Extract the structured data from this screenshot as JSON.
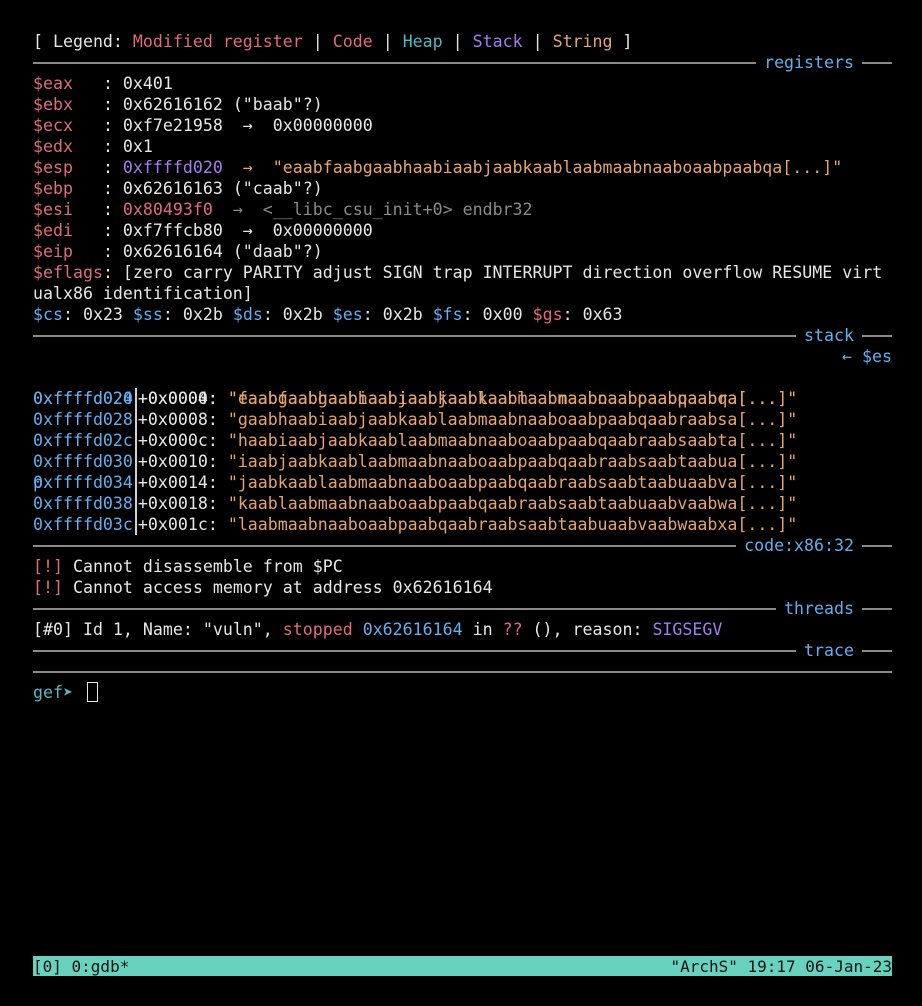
{
  "legend": {
    "open": "[ Legend: ",
    "modified": "Modified register",
    "sep1": " | ",
    "code": "Code",
    "sep2": " | ",
    "heap": "Heap",
    "sep3": " | ",
    "stack": "Stack",
    "sep4": " | ",
    "string": "String",
    "close": " ]"
  },
  "sections": {
    "registers": "registers",
    "stack": "stack",
    "code": "code:x86:32",
    "threads": "threads",
    "trace": "trace"
  },
  "registers": [
    {
      "name": "$eax",
      "sep": "   : ",
      "value": "0x401",
      "value_class": "",
      "tail": "",
      "tail_class": ""
    },
    {
      "name": "$ebx",
      "sep": "   : ",
      "value": "0x62616162 (\"baab\"?)",
      "value_class": "",
      "tail": "",
      "tail_class": ""
    },
    {
      "name": "$ecx",
      "sep": "   : ",
      "value": "0xf7e21958  →  0x00000000",
      "value_class": "",
      "tail": "",
      "tail_class": ""
    },
    {
      "name": "$edx",
      "sep": "   : ",
      "value": "0x1",
      "value_class": "",
      "tail": "",
      "tail_class": ""
    },
    {
      "name": "$esp",
      "sep": "   : ",
      "value": "0xffffd020",
      "value_class": "purple",
      "tail": "  →  \"eaabfaabgaabhaabiaabjaabkaablaabmaabnaaboaabpaabqa[...]\"",
      "tail_class": "orange"
    },
    {
      "name": "$ebp",
      "sep": "   : ",
      "value": "0x62616163 (\"caab\"?)",
      "value_class": "",
      "tail": "",
      "tail_class": ""
    },
    {
      "name": "$esi",
      "sep": "   : ",
      "value": "0x80493f0",
      "value_class": "red",
      "tail": "  →  <__libc_csu_init+0> endbr32",
      "tail_class": "gray"
    },
    {
      "name": "$edi",
      "sep": "   : ",
      "value": "0xf7ffcb80  →  0x00000000",
      "value_class": "",
      "tail": "",
      "tail_class": ""
    },
    {
      "name": "$eip",
      "sep": "   : ",
      "value": "0x62616164 (\"daab\"?)",
      "value_class": "",
      "tail": "",
      "tail_class": ""
    }
  ],
  "eflags": {
    "name": "$eflags",
    "value": ": [zero carry PARITY adjust SIGN trap INTERRUPT direction overflow RESUME virtualx86 identification]"
  },
  "segments": [
    {
      "name": "$cs",
      "value": ": 0x23 "
    },
    {
      "name": "$ss",
      "value": ": 0x2b "
    },
    {
      "name": "$ds",
      "value": ": 0x2b "
    },
    {
      "name": "$es",
      "value": ": 0x2b "
    },
    {
      "name": "$fs",
      "value": ": 0x00 "
    },
    {
      "name": "$gs",
      "value": ": 0x63"
    }
  ],
  "stack": [
    {
      "addr": "0xffffd020",
      "offset": "+0x0000: ",
      "value": "\"eaabfaabgaabhaabiaabjaabkaablaabmaabnaaboaabpaabqa[...]\"",
      "esp_tag": "← $es",
      "esp_wrap": "p"
    },
    {
      "addr": "0xffffd024",
      "offset": "+0x0004: ",
      "value": "\"faabgaabhaabiaabjaabkaablaabmaabnaaboaabpaabqaabra[...]\""
    },
    {
      "addr": "0xffffd028",
      "offset": "+0x0008: ",
      "value": "\"gaabhaabiaabjaabkaablaabmaabnaaboaabpaabqaabraabsa[...]\""
    },
    {
      "addr": "0xffffd02c",
      "offset": "+0x000c: ",
      "value": "\"haabiaabjaabkaablaabmaabnaaboaabpaabqaabraabsaabta[...]\""
    },
    {
      "addr": "0xffffd030",
      "offset": "+0x0010: ",
      "value": "\"iaabjaabkaablaabmaabnaaboaabpaabqaabraabsaabtaabua[...]\""
    },
    {
      "addr": "0xffffd034",
      "offset": "+0x0014: ",
      "value": "\"jaabkaablaabmaabnaaboaabpaabqaabraabsaabtaabuaabva[...]\""
    },
    {
      "addr": "0xffffd038",
      "offset": "+0x0018: ",
      "value": "\"kaablaabmaabnaaboaabpaabqaabraabsaabtaabuaabvaabwa[...]\""
    },
    {
      "addr": "0xffffd03c",
      "offset": "+0x001c: ",
      "value": "\"laabmaabnaaboaabpaabqaabraabsaabtaabuaabvaabwaabxa[...]\""
    }
  ],
  "code_errors": [
    {
      "tag": "[!]",
      "text": " Cannot disassemble from $PC"
    },
    {
      "tag": "[!]",
      "text": " Cannot access memory at address 0x62616164"
    }
  ],
  "thread": {
    "id_tag": "[#0]",
    "part1": " Id 1, Name: \"vuln\", ",
    "state": "stopped",
    "space1": " ",
    "addr": "0x62616164",
    "part2": " in ",
    "func": "??",
    "part3": " (), reason: ",
    "reason": "SIGSEGV"
  },
  "prompt": "gef➤ ",
  "status_bar": {
    "left": "[0] 0:gdb*",
    "right": "\"ArchS\" 19:17 06-Jan-23"
  },
  "colors": {
    "background": "#000000",
    "modified": "#e06c75",
    "code": "#e06c75",
    "heap": "#56b6c2",
    "stack": "#a47cf0",
    "string": "#e5a36e",
    "section_title": "#61afef",
    "status_bar": "#69d2bf"
  }
}
